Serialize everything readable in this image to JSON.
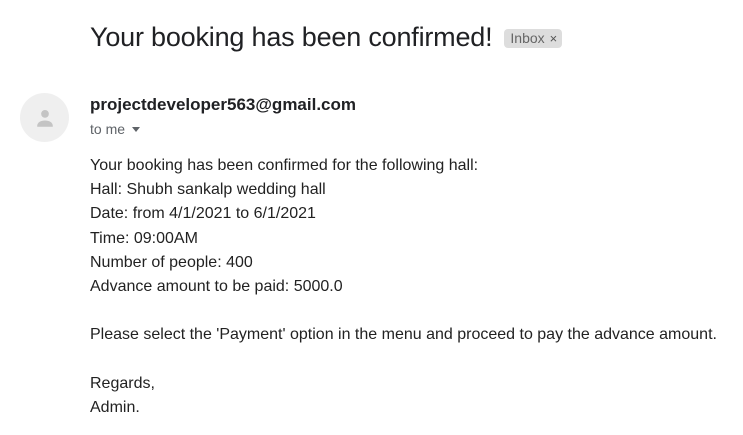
{
  "email": {
    "subject": "Your booking has been confirmed!",
    "label": "Inbox",
    "label_remove_glyph": "×",
    "sender": "projectdeveloper563@gmail.com",
    "recipient_text": "to me",
    "body_lines": [
      "Your booking has been confirmed for the following hall:",
      "Hall: Shubh sankalp wedding hall",
      "Date: from 4/1/2021 to 6/1/2021",
      "Time: 09:00AM",
      "Number of people: 400",
      "Advance amount to be paid: 5000.0",
      "",
      "Please select the 'Payment' option in the menu and proceed to pay the advance amount.",
      "",
      "Regards,",
      "Admin."
    ]
  },
  "icons": {
    "avatar": "person-icon",
    "recipient_toggle": "caret-down-icon",
    "label_remove": "close-icon"
  },
  "colors": {
    "avatar_bg": "#efefef",
    "avatar_icon": "#c4c4c4",
    "label_chip_bg": "#dddddd"
  }
}
